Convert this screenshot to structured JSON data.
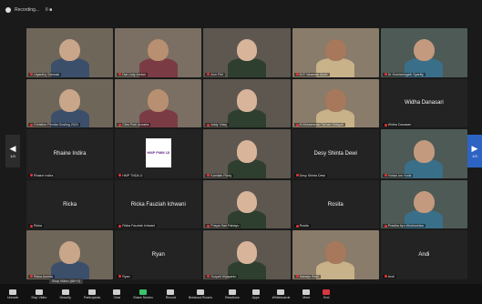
{
  "window": {
    "recording_label": "Recording...",
    "controls": "II  ■"
  },
  "tooltip": "Stop Video (Alt+V)",
  "tiles": [
    {
      "caption": "Lilyanthy Samosir",
      "video": true,
      "name": ""
    },
    {
      "caption": "Dwi Listy Ambar",
      "video": true,
      "name": ""
    },
    {
      "caption": "Ann Fitri",
      "video": true,
      "name": ""
    },
    {
      "caption": "M.F. Iskandar Alwin",
      "video": true,
      "name": ""
    },
    {
      "caption": "Dr Kurnianingsih Syarifg",
      "video": true,
      "name": ""
    },
    {
      "caption": "Christine Pernita Gosling 2024",
      "video": true,
      "name": ""
    },
    {
      "caption": "Citra Putri Anzarta",
      "video": true,
      "name": ""
    },
    {
      "caption": "Addy Vicky",
      "video": true,
      "name": ""
    },
    {
      "caption": "M.Muhammad Tarhan Hidayat",
      "video": true,
      "name": ""
    },
    {
      "caption": "Widha Danasari",
      "video": false,
      "name": "Widha Danasari"
    },
    {
      "caption": "Rhaine Indira",
      "video": false,
      "name": "Rhaine Indira"
    },
    {
      "caption": "HMP TNDA IJ",
      "video": false,
      "name": "",
      "logo": "HMP PMM IJI"
    },
    {
      "caption": "Kamilah Rizky",
      "video": true,
      "name": ""
    },
    {
      "caption": "Desy Shinta Dewi",
      "video": false,
      "name": "Desy Shinta Dewi"
    },
    {
      "caption": "Yohan Iva Yunik",
      "video": true,
      "name": ""
    },
    {
      "caption": "Ricka",
      "video": false,
      "name": "Ricka"
    },
    {
      "caption": "Ricka Fauziah Ichwani",
      "video": false,
      "name": "Ricka Fauziah Ichwani"
    },
    {
      "caption": "Puspa Sari Rahayu",
      "video": true,
      "name": ""
    },
    {
      "caption": "Rosita",
      "video": false,
      "name": "Rosita"
    },
    {
      "caption": "Prasika Ayu Khoirunnisa",
      "video": true,
      "name": ""
    },
    {
      "caption": "Riska Amelia",
      "video": true,
      "name": ""
    },
    {
      "caption": "Ryan",
      "video": false,
      "name": "Ryan"
    },
    {
      "caption": "Suryati Wijayanto",
      "video": true,
      "name": ""
    },
    {
      "caption": "Saharjo Rizki",
      "video": true,
      "name": ""
    },
    {
      "caption": "Andi",
      "video": false,
      "name": "Andi"
    }
  ],
  "nav": {
    "left_page": "1/3",
    "right_page": "1/3"
  },
  "toolbar": {
    "items": [
      {
        "label": "Unmute",
        "icon": "mic-icon"
      },
      {
        "label": "Stop Video",
        "icon": "video-camera-icon"
      },
      {
        "label": "Security",
        "icon": "shield-icon"
      },
      {
        "label": "Participants",
        "icon": "participants-icon"
      },
      {
        "label": "Chat",
        "icon": "chat-icon"
      },
      {
        "label": "Share Screen",
        "icon": "share-screen-icon",
        "accent": "#3cc36b"
      },
      {
        "label": "Record",
        "icon": "record-icon"
      },
      {
        "label": "Breakout Rooms",
        "icon": "breakout-icon"
      },
      {
        "label": "Reactions",
        "icon": "reactions-icon"
      },
      {
        "label": "Apps",
        "icon": "apps-icon"
      },
      {
        "label": "Whiteboards",
        "icon": "whiteboard-icon"
      },
      {
        "label": "More",
        "icon": "more-icon"
      },
      {
        "label": "End",
        "icon": "end-icon",
        "accent": "#d9363e"
      }
    ]
  },
  "colors": {
    "background": "#1a1a1a",
    "tile": "#232323",
    "accent_green": "#3cc36b",
    "accent_red": "#d9363e",
    "page_arrow": "#2d64c4"
  }
}
